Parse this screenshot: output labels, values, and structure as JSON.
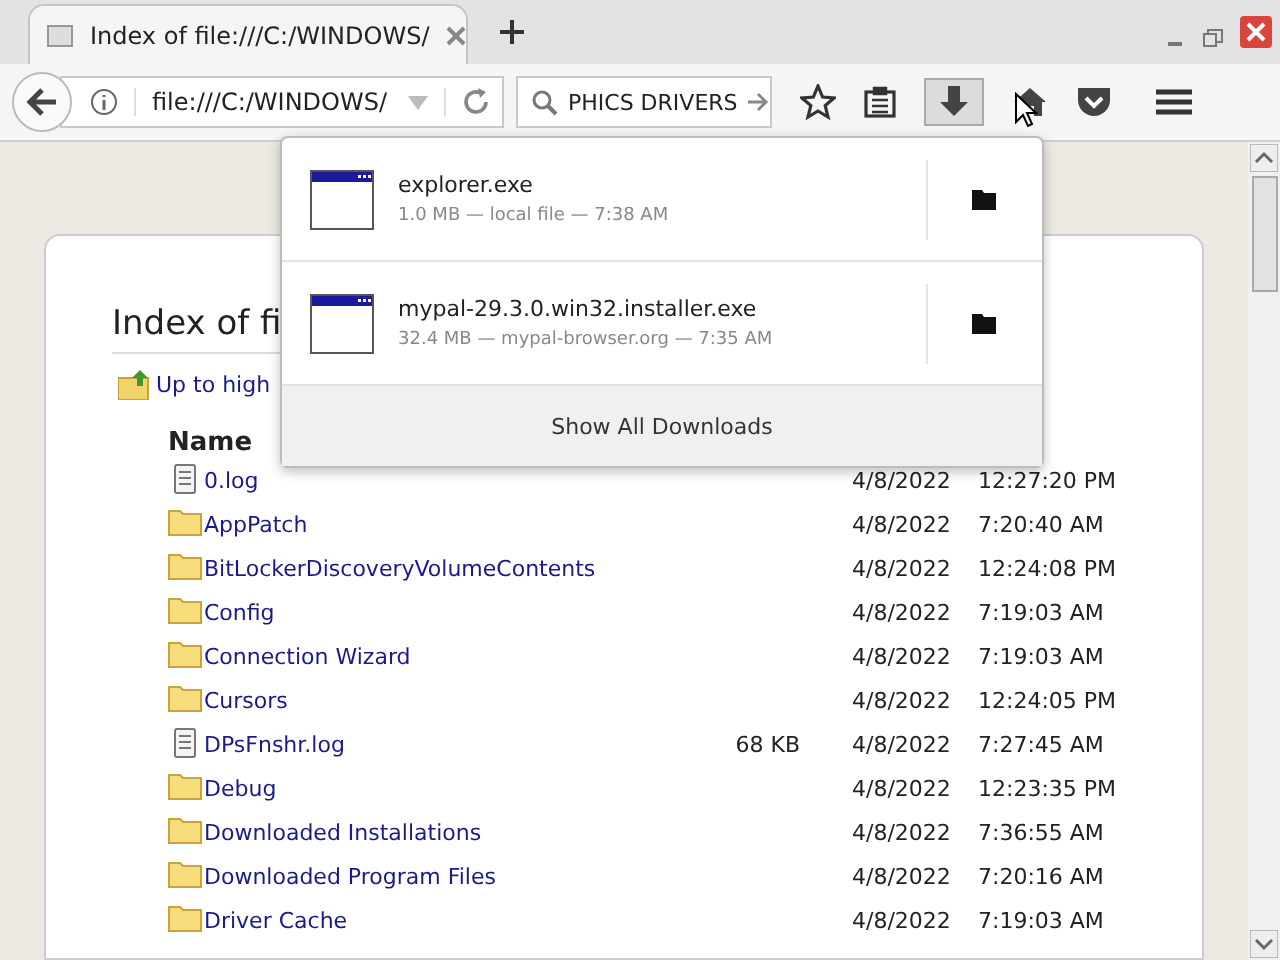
{
  "tab": {
    "title": "Index of file:///C:/WINDOWS/"
  },
  "toolbar": {
    "url": "file:///C:/WINDOWS/",
    "search_value": "PHICS DRIVERS",
    "downloads_open": true
  },
  "downloads": [
    {
      "name": "explorer.exe",
      "details": "1.0 MB — local file — 7:38 AM"
    },
    {
      "name": "mypal-29.3.0.win32.installer.exe",
      "details": "32.4 MB — mypal-browser.org — 7:35 AM"
    }
  ],
  "show_all": "Show All Downloads",
  "page": {
    "heading": "Index of fi",
    "up_link": "Up to high",
    "name_column": "Name",
    "rows": [
      {
        "kind": "file",
        "name": "0.log",
        "size": "",
        "date": "4/8/2022",
        "time": "12:27:20 PM"
      },
      {
        "kind": "folder",
        "name": "AppPatch",
        "size": "",
        "date": "4/8/2022",
        "time": "7:20:40 AM"
      },
      {
        "kind": "folder",
        "name": "BitLockerDiscoveryVolumeContents",
        "size": "",
        "date": "4/8/2022",
        "time": "12:24:08 PM"
      },
      {
        "kind": "folder",
        "name": "Config",
        "size": "",
        "date": "4/8/2022",
        "time": "7:19:03 AM"
      },
      {
        "kind": "folder",
        "name": "Connection Wizard",
        "size": "",
        "date": "4/8/2022",
        "time": "7:19:03 AM"
      },
      {
        "kind": "folder",
        "name": "Cursors",
        "size": "",
        "date": "4/8/2022",
        "time": "12:24:05 PM"
      },
      {
        "kind": "file",
        "name": "DPsFnshr.log",
        "size": "68 KB",
        "date": "4/8/2022",
        "time": "7:27:45 AM"
      },
      {
        "kind": "folder",
        "name": "Debug",
        "size": "",
        "date": "4/8/2022",
        "time": "12:23:35 PM"
      },
      {
        "kind": "folder",
        "name": "Downloaded Installations",
        "size": "",
        "date": "4/8/2022",
        "time": "7:36:55 AM"
      },
      {
        "kind": "folder",
        "name": "Downloaded Program Files",
        "size": "",
        "date": "4/8/2022",
        "time": "7:20:16 AM"
      },
      {
        "kind": "folder",
        "name": "Driver Cache",
        "size": "",
        "date": "4/8/2022",
        "time": "7:19:03 AM"
      }
    ]
  }
}
